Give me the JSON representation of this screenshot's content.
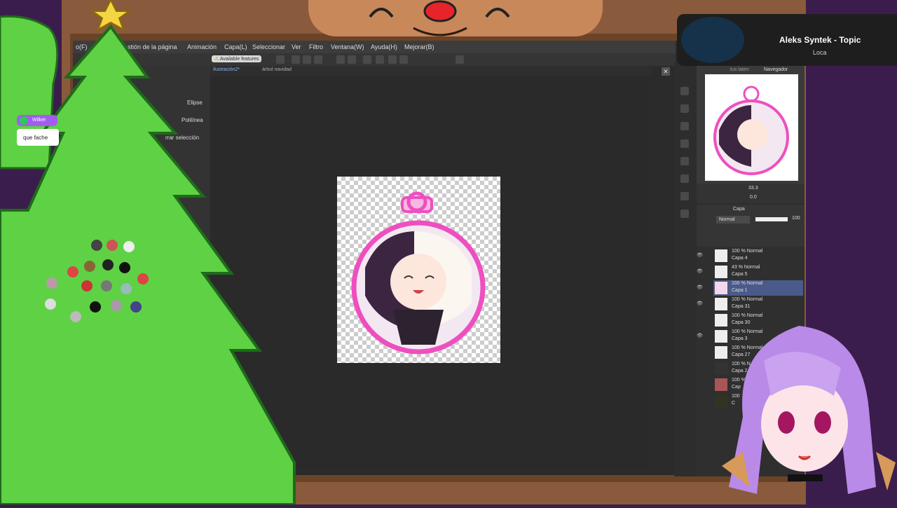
{
  "menubar": {
    "items": [
      "o(F)",
      "stión de la página",
      "Animación",
      "Capa(L)",
      "Seleccionar",
      "Ver",
      "Filtro",
      "Ventana(W)",
      "Ayuda(H)",
      "Mejorar(B)"
    ]
  },
  "commandbar": {
    "features_label": "Available features"
  },
  "tabs": [
    "ilustración2*",
    "árbol navidad"
  ],
  "tool_options": {
    "ellipse": "Elipse",
    "polyline": "Polilínea",
    "clear_selection": "rrar selección"
  },
  "chat": {
    "username": "Wilker",
    "message": "que fache"
  },
  "now_playing": {
    "title": "Aleks Syntek - Topic",
    "subtitle": "Loca"
  },
  "navigator": {
    "tab1": "tus laten",
    "tab2": "Navegador",
    "zoom": "33.3",
    "rotation": "0.0"
  },
  "layer_panel": {
    "tab": "Capa",
    "blend_mode": "Normal",
    "opacity": "100",
    "layers": [
      {
        "percent": "100 % Normal",
        "name": "Capa 4"
      },
      {
        "percent": "43 % Normal",
        "name": "Capa 5"
      },
      {
        "percent": "100 % Normal",
        "name": "Capa 1"
      },
      {
        "percent": "100 % Normal",
        "name": "Capa 31"
      },
      {
        "percent": "100 % Normal",
        "name": "Capa 30"
      },
      {
        "percent": "100 % Normal",
        "name": "Capa 3"
      },
      {
        "percent": "100 % Normal",
        "name": "Capa 27"
      },
      {
        "percent": "100 % N",
        "name": "Capa 2"
      },
      {
        "percent": "100 %",
        "name": "Cap"
      },
      {
        "percent": "100",
        "name": "C"
      }
    ]
  },
  "colors": {
    "tree": "#5fd145",
    "tree_outline": "#1e6b1a",
    "ornament_pink": "#ee4fc0",
    "selected_layer": "#4a5a8a",
    "vtuber_hair": "#b98ae8"
  }
}
